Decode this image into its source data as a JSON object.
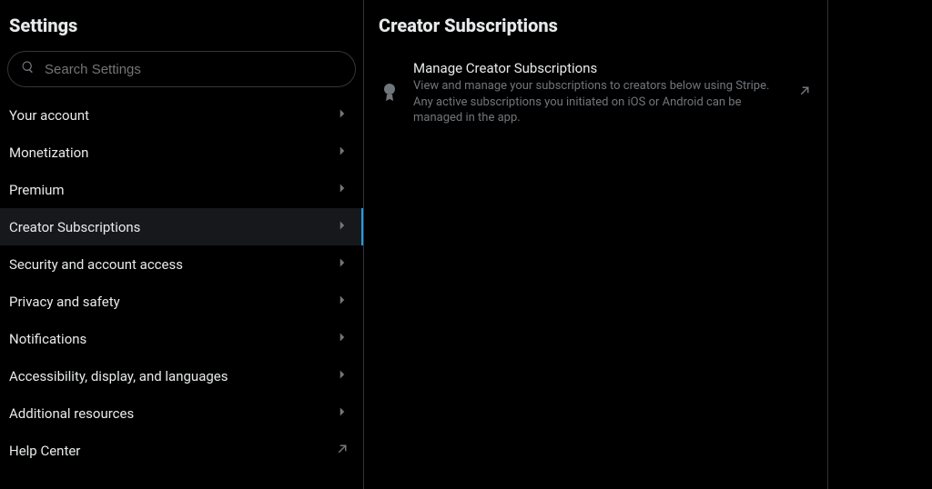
{
  "sidebar": {
    "title": "Settings",
    "search": {
      "placeholder": "Search Settings"
    },
    "items": [
      {
        "label": "Your account",
        "icon": "chevron"
      },
      {
        "label": "Monetization",
        "icon": "chevron"
      },
      {
        "label": "Premium",
        "icon": "chevron"
      },
      {
        "label": "Creator Subscriptions",
        "icon": "chevron",
        "active": true
      },
      {
        "label": "Security and account access",
        "icon": "chevron"
      },
      {
        "label": "Privacy and safety",
        "icon": "chevron"
      },
      {
        "label": "Notifications",
        "icon": "chevron"
      },
      {
        "label": "Accessibility, display, and languages",
        "icon": "chevron"
      },
      {
        "label": "Additional resources",
        "icon": "chevron"
      },
      {
        "label": "Help Center",
        "icon": "external"
      }
    ]
  },
  "main": {
    "title": "Creator Subscriptions",
    "card": {
      "heading": "Manage Creator Subscriptions",
      "description": "View and manage your subscriptions to creators below using Stripe. Any active subscriptions you initiated on iOS or Android can be managed in the app."
    }
  }
}
